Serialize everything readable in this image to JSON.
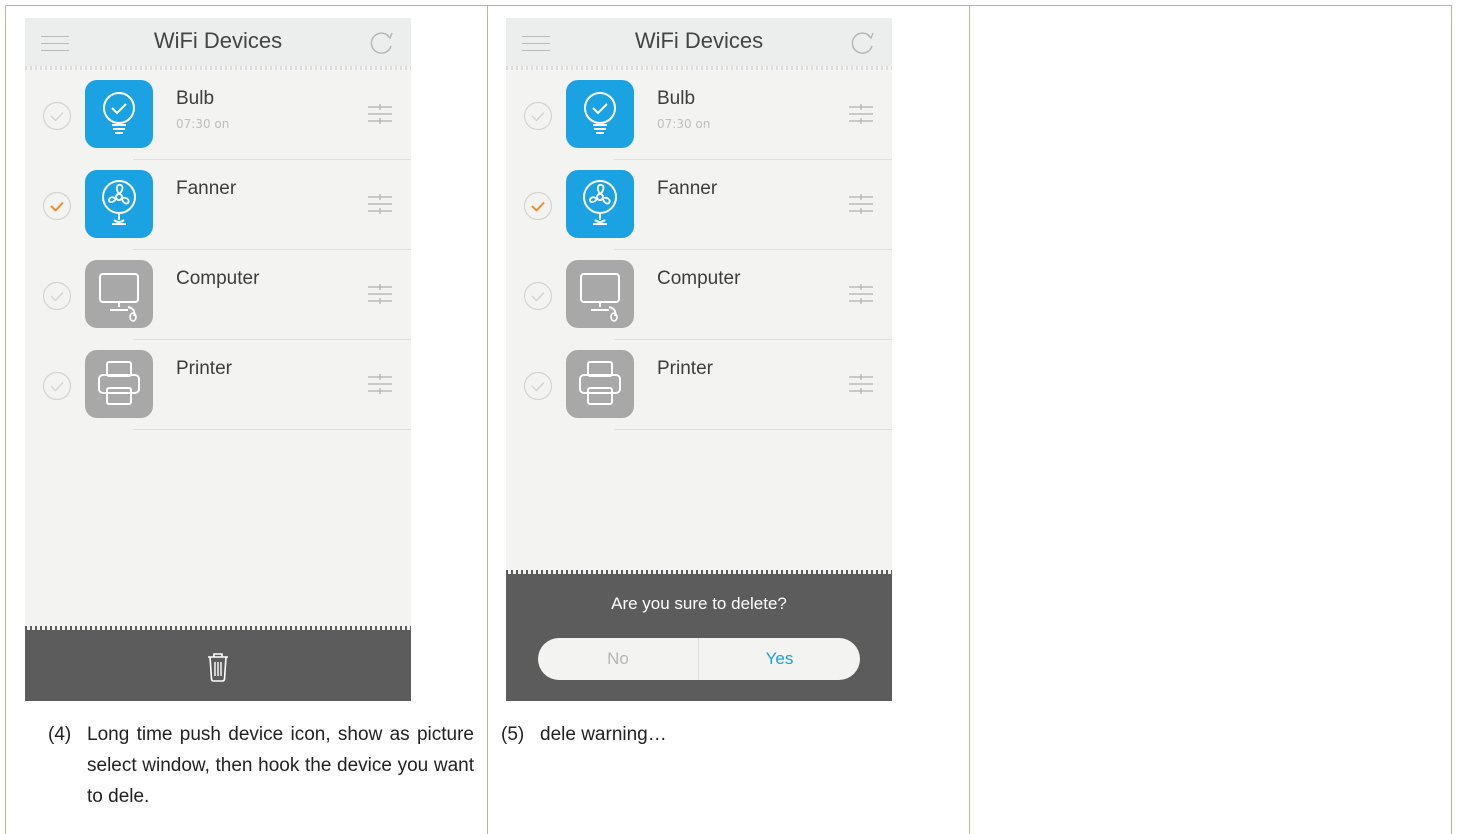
{
  "app": {
    "title": "WiFi Devices"
  },
  "devices": [
    {
      "name": "Bulb",
      "status": "07:30 on",
      "icon": "bulb-icon",
      "color": "#1ba2e3",
      "checked": false
    },
    {
      "name": "Fanner",
      "status": "",
      "icon": "fan-icon",
      "color": "#1ba2e3",
      "checked": true
    },
    {
      "name": "Computer",
      "status": "",
      "icon": "computer-icon",
      "color": "#a8a8a8",
      "checked": false
    },
    {
      "name": "Printer",
      "status": "",
      "icon": "printer-icon",
      "color": "#a8a8a8",
      "checked": false
    }
  ],
  "screen1": {
    "bottom_action_icon": "trash-icon",
    "caption_num": "(4)",
    "caption": "Long time push device icon, show as picture select window, then hook the device you want to dele."
  },
  "screen2": {
    "dialog_message": "Are you sure to delete?",
    "no_label": "No",
    "yes_label": "Yes",
    "caption_num": "(5)",
    "caption": "dele warning…"
  },
  "colors": {
    "accent_blue": "#1ba2e3",
    "check_orange": "#f08c2b",
    "bar_dark": "#5c5c5c",
    "table_border": "#c2b591"
  }
}
